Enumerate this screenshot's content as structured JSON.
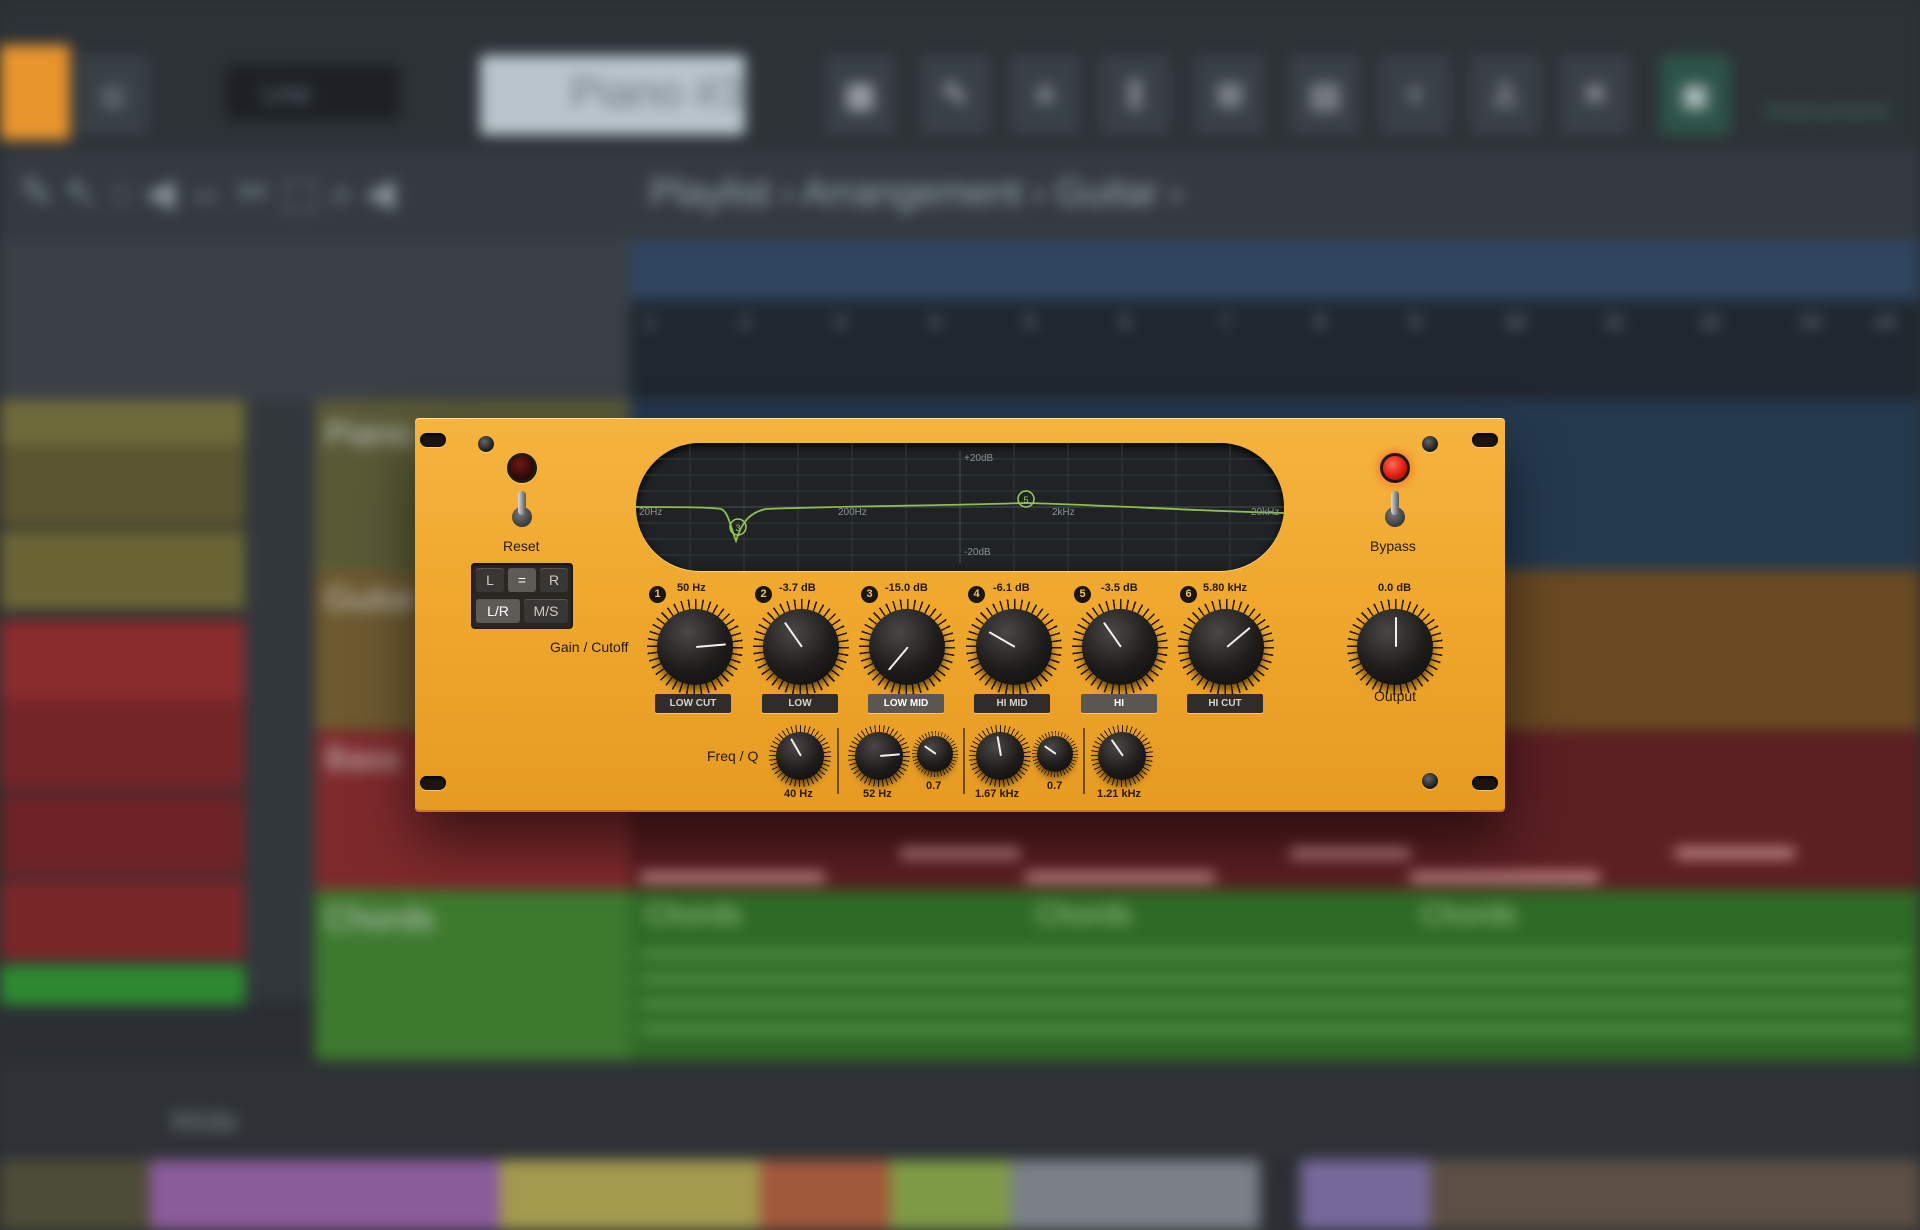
{
  "daw": {
    "preset_name": "Piano #3",
    "line_label": "Line",
    "breadcrumb": "Playlist › Arrangement › Guitar ›",
    "ruler": [
      "1",
      "2",
      "3",
      "4",
      "5",
      "6",
      "7",
      "8",
      "9",
      "10",
      "11",
      "12",
      "13",
      "14"
    ],
    "tracks": [
      "Piano",
      "Guitar",
      "Bass",
      "Chords"
    ],
    "clips": [
      "Chords",
      "Chords",
      "Chords"
    ],
    "bottom_label": "Wide",
    "top_right": "Instrument"
  },
  "plugin": {
    "reset_label": "Reset",
    "bypass_label": "Bypass",
    "gain_cutoff_label": "Gain / Cutoff",
    "freq_q_label": "Freq / Q",
    "output_label": "Output",
    "output_value": "0.0 dB",
    "channel_buttons": [
      "L",
      "=",
      "R",
      "L/R",
      "M/S"
    ],
    "display": {
      "db_top": "+20dB",
      "db_bottom": "-20dB",
      "freq_labels": [
        "20Hz",
        "200Hz",
        "2kHz",
        "20kHz"
      ],
      "node_labels": [
        "3",
        "5"
      ]
    },
    "bands": [
      {
        "num": "1",
        "value": "50 Hz",
        "type": "LOW CUT",
        "active": false
      },
      {
        "num": "2",
        "value": "-3.7 dB",
        "type": "LOW",
        "active": false
      },
      {
        "num": "3",
        "value": "-15.0 dB",
        "type": "LOW MID",
        "active": true
      },
      {
        "num": "4",
        "value": "-6.1 dB",
        "type": "HI MID",
        "active": false
      },
      {
        "num": "5",
        "value": "-3.5 dB",
        "type": "HI",
        "active": true
      },
      {
        "num": "6",
        "value": "5.80 kHz",
        "type": "HI CUT",
        "active": false
      }
    ],
    "freq_values": [
      "40 Hz",
      "52 Hz",
      "0.7",
      "1.67 kHz",
      "0.7",
      "1.21 kHz"
    ]
  }
}
